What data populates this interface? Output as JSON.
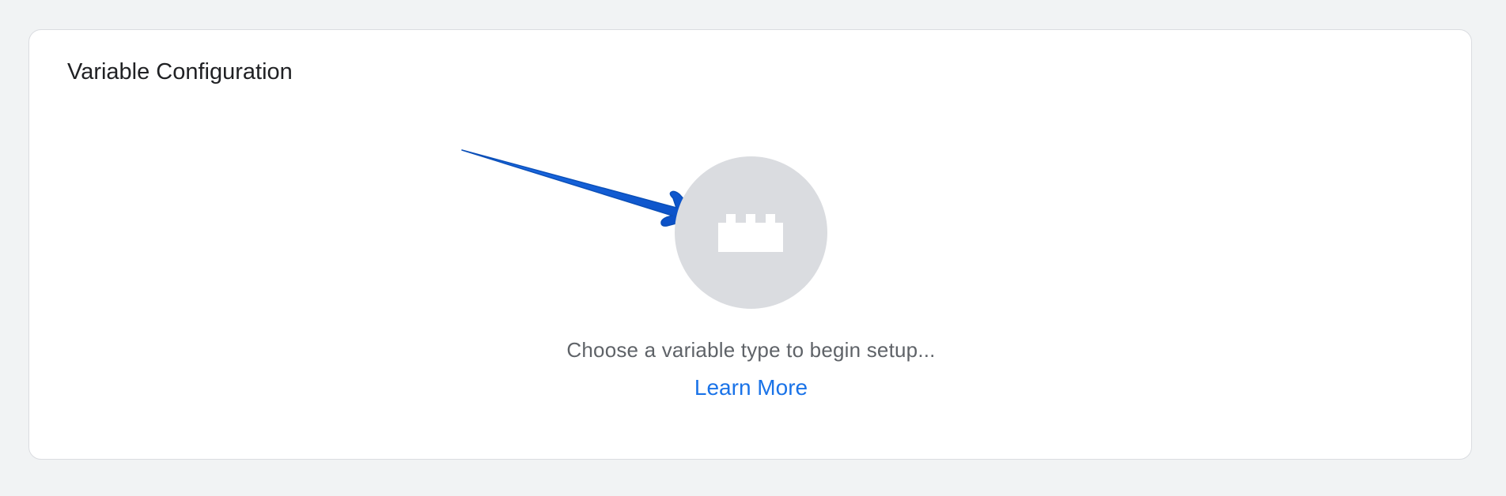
{
  "card": {
    "title": "Variable Configuration",
    "hint": "Choose a variable type to begin setup...",
    "learn_more": "Learn More",
    "icon": "brick-icon",
    "annotation": "arrow-icon"
  },
  "colors": {
    "page_background": "#f1f3f4",
    "card_background": "#ffffff",
    "circle": "#dadce0",
    "link": "#1a73e8",
    "hint_text": "#5f6368",
    "arrow": "#0b5fd6"
  }
}
